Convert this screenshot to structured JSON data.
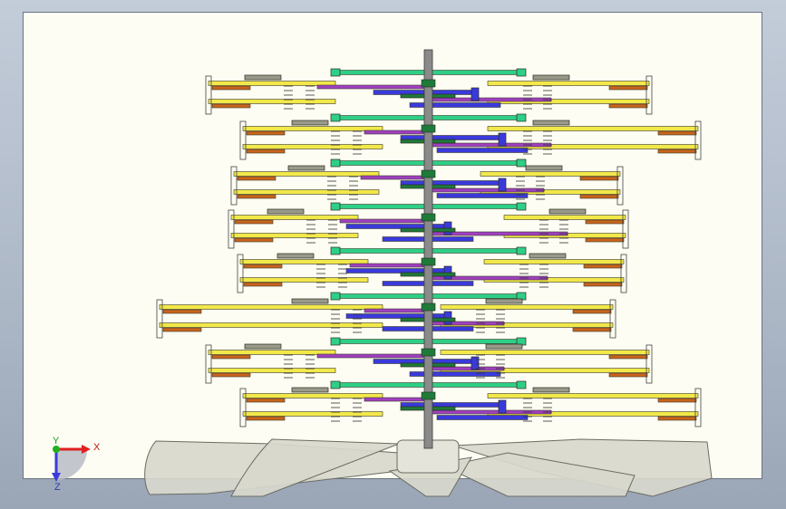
{
  "viewport": {
    "background": "#fdfdf3",
    "colors": {
      "shaft": "#8a8a8a",
      "hub_link": "#2ecf86",
      "arm": "#f2e84a",
      "rod": "#c8641c",
      "purple": "#a040c0",
      "blue": "#3a3adc",
      "gray_block": "#9a9a8a",
      "dark_green": "#1f7a3a",
      "blade": "#d8d8cc",
      "blade_edge": "#6c6c64"
    }
  },
  "triad": {
    "x_label": "X",
    "y_label": "Y",
    "z_label": "Z",
    "x_color": "#e02020",
    "y_color": "#20b020",
    "z_color": "#3a3adc"
  }
}
